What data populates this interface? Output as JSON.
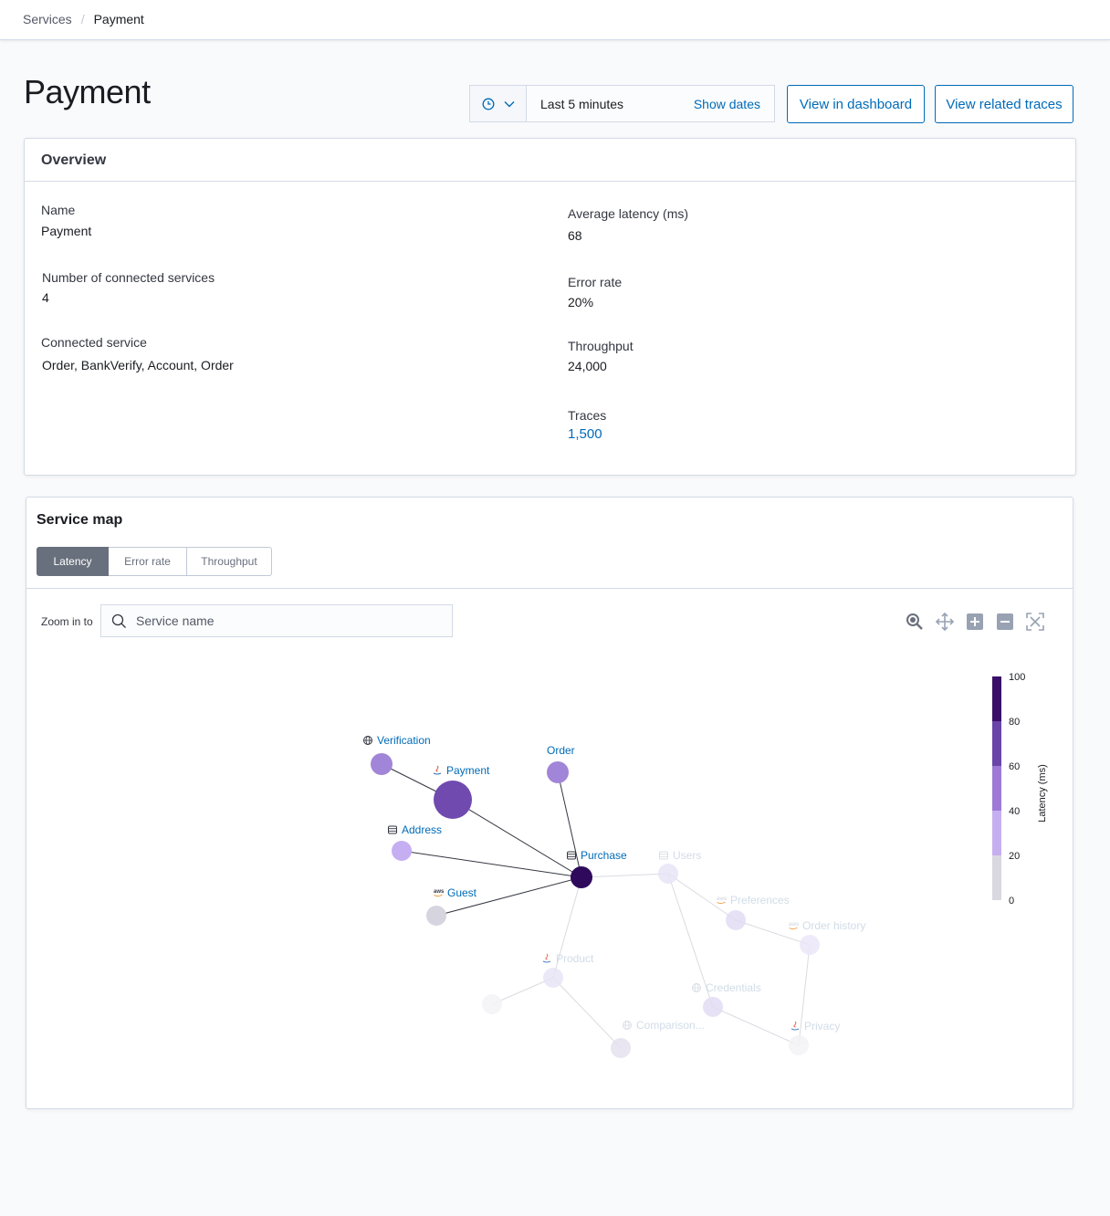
{
  "breadcrumb": {
    "parent": "Services",
    "current": "Payment"
  },
  "page": {
    "title": "Payment"
  },
  "datepicker": {
    "label": "Last 5 minutes",
    "show_dates": "Show dates"
  },
  "actions": {
    "dashboard": "View in dashboard",
    "traces": "View related traces"
  },
  "overview": {
    "heading": "Overview",
    "name_label": "Name",
    "name_value": "Payment",
    "connected_count_label": "Number of connected services",
    "connected_count_value": "4",
    "connected_label": "Connected service",
    "connected_value": "Order, BankVerify, Account, Order",
    "latency_label": "Average latency (ms)",
    "latency_value": "68",
    "error_label": "Error rate",
    "error_value": "20%",
    "throughput_label": "Throughput",
    "throughput_value": "24,000",
    "traces_label": "Traces",
    "traces_value": "1,500"
  },
  "service_map": {
    "heading": "Service map",
    "tabs": [
      "Latency",
      "Error rate",
      "Throughput"
    ],
    "active_tab": "Latency",
    "zoom_label": "Zoom in to",
    "search_placeholder": "Service name",
    "tools": [
      "zoom-inspect",
      "pan",
      "zoom-in",
      "zoom-out",
      "fit-to-screen"
    ],
    "legend": {
      "title": "Latency (ms)",
      "ticks": [
        "100",
        "80",
        "60",
        "40",
        "20",
        "0"
      ],
      "colors": [
        "#3a0f68",
        "#6a45a8",
        "#9e7ad6",
        "#c6aff0",
        "#d9d8e0"
      ]
    },
    "nodes": [
      {
        "id": "verification",
        "label": "Verification",
        "icon": "globe-icon",
        "color": "#a185d8",
        "latency_band": "60-80",
        "highlighted": true
      },
      {
        "id": "payment",
        "label": "Payment",
        "icon": "java-icon",
        "color": "#704aae",
        "latency_band": "60-80",
        "highlighted": true
      },
      {
        "id": "order",
        "label": "Order",
        "icon": "",
        "color": "#a185d8",
        "latency_band": "60-80",
        "highlighted": true
      },
      {
        "id": "address",
        "label": "Address",
        "icon": "database-icon",
        "color": "#c5aef2",
        "latency_band": "40-60",
        "highlighted": true
      },
      {
        "id": "purchase",
        "label": "Purchase",
        "icon": "database-icon",
        "color": "#2f0a5c",
        "latency_band": "80-100",
        "highlighted": true
      },
      {
        "id": "guest",
        "label": "Guest",
        "icon": "aws-icon",
        "color": "#d6d4de",
        "latency_band": "0-20",
        "highlighted": true
      },
      {
        "id": "users",
        "label": "Users",
        "icon": "database-icon",
        "color": "#e8e4f6",
        "highlighted": false
      },
      {
        "id": "preferences",
        "label": "Preferences",
        "icon": "aws-icon",
        "color": "#e3dcf4",
        "highlighted": false
      },
      {
        "id": "orderhistory",
        "label": "Order history",
        "icon": "aws-icon",
        "color": "#ece7f8",
        "highlighted": false
      },
      {
        "id": "product",
        "label": "Product",
        "icon": "java-icon",
        "color": "#e8e4f6",
        "highlighted": false
      },
      {
        "id": "unnamed",
        "label": "",
        "icon": "",
        "color": "#f3f3f6",
        "highlighted": false
      },
      {
        "id": "credentials",
        "label": "Credentials",
        "icon": "globe-icon",
        "color": "#e3dcf4",
        "highlighted": false
      },
      {
        "id": "comparison",
        "label": "Comparison...",
        "icon": "globe-icon",
        "color": "#e5e0ee",
        "highlighted": false
      },
      {
        "id": "privacy",
        "label": "Privacy",
        "icon": "java-icon",
        "color": "#f3f3f6",
        "highlighted": false
      }
    ],
    "edges": [
      [
        "verification",
        "payment"
      ],
      [
        "payment",
        "purchase"
      ],
      [
        "order",
        "purchase"
      ],
      [
        "address",
        "purchase"
      ],
      [
        "guest",
        "purchase"
      ],
      [
        "purchase",
        "users"
      ],
      [
        "purchase",
        "product"
      ],
      [
        "users",
        "preferences"
      ],
      [
        "users",
        "credentials"
      ],
      [
        "preferences",
        "orderhistory"
      ],
      [
        "orderhistory",
        "privacy"
      ],
      [
        "credentials",
        "privacy"
      ],
      [
        "product",
        "unnamed"
      ],
      [
        "product",
        "comparison"
      ]
    ]
  }
}
